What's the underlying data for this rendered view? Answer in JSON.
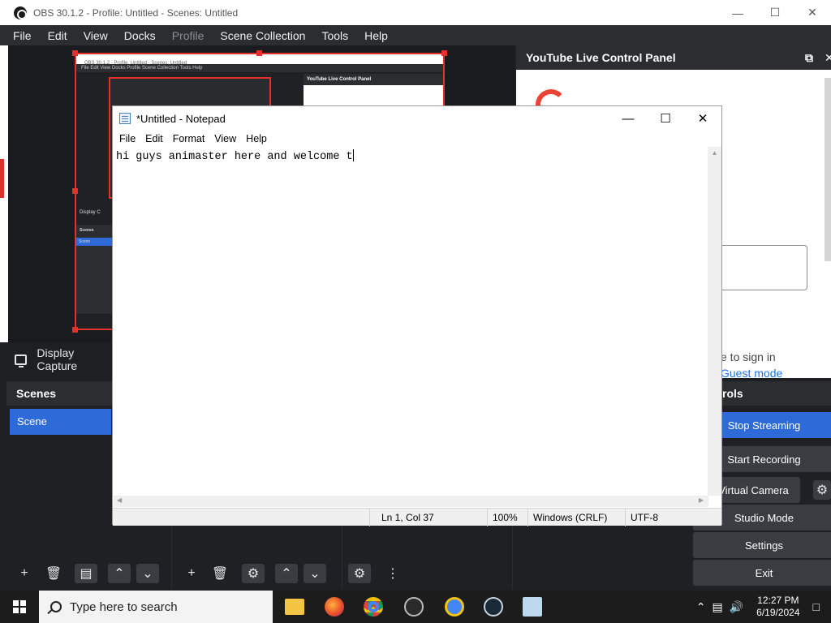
{
  "obs": {
    "title": "OBS 30.1.2 - Profile: Untitled - Scenes: Untitled",
    "menu": [
      "File",
      "Edit",
      "View",
      "Docks",
      "Profile",
      "Scene Collection",
      "Tools",
      "Help"
    ],
    "source_name": "Display Capture",
    "scenes_title": "Scenes",
    "scene_item": "Scene",
    "youtube_title": "YouTube Live Control Panel",
    "youtube_sign_in": "e to sign in",
    "youtube_guest": "Guest mode",
    "controls_title": "rols",
    "controls": {
      "stop_streaming": "Stop Streaming",
      "start_recording": "Start Recording",
      "virtual_camera": "t Virtual Camera",
      "studio_mode": "Studio Mode",
      "settings": "Settings",
      "exit": "Exit"
    },
    "mini": {
      "title": "OBS 30.1.2 - Profile: Untitled - Scenes: Untitled",
      "menu": "File  Edit  View  Docks  Profile  Scene Collection  Tools  Help",
      "dock": "YouTube Live Control Panel",
      "display_capture": "Display C",
      "scenes": "Scenes",
      "scene": "Scene"
    }
  },
  "notepad": {
    "title": "*Untitled - Notepad",
    "menu": [
      "File",
      "Edit",
      "Format",
      "View",
      "Help"
    ],
    "text": "hi guys animaster here and welcome t",
    "status": {
      "position": "Ln 1, Col 37",
      "zoom": "100%",
      "line_endings": "Windows (CRLF)",
      "encoding": "UTF-8"
    }
  },
  "taskbar": {
    "search_placeholder": "Type here to search",
    "time": "12:27 PM",
    "date": "6/19/2024"
  },
  "colors": {
    "obs_accent": "#2e6bd8",
    "selection_red": "#e3312b",
    "dock_bg": "#2b2d31"
  }
}
